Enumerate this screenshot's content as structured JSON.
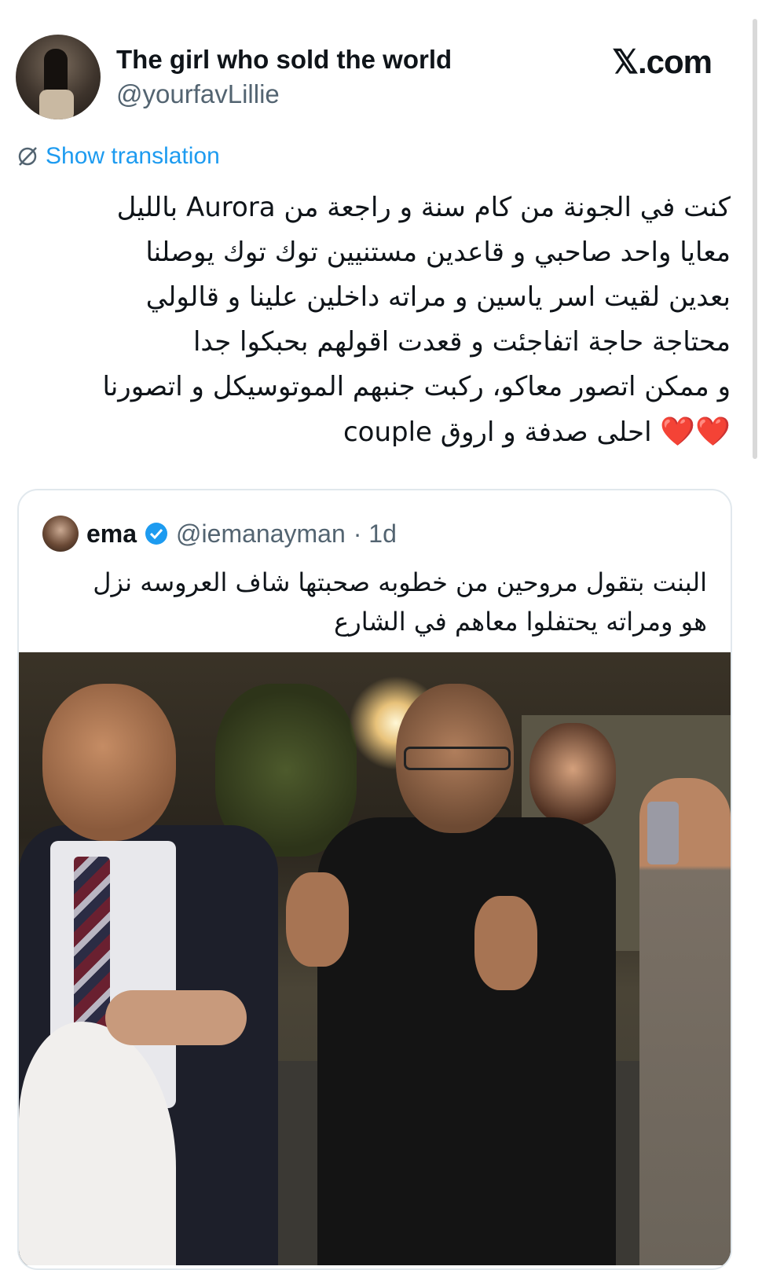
{
  "author": {
    "display_name": "The girl who sold the world",
    "handle": "@yourfavLillie"
  },
  "brand": "𝕏.com",
  "translate_label": "Show translation",
  "tweet_lines": [
    "كنت في الجونة من كام سنة و راجعة من Aurora بالليل",
    "معايا واحد صاحبي و قاعدين مستنيين توك توك يوصلنا",
    "بعدين لقيت اسر ياسين و مراته داخلين علينا و قالولي",
    "محتاجة حاجة اتفاجئت        و قعدت اقولهم بحبكوا جدا",
    "و ممكن اتصور معاكو، ركبت جنبهم الموتوسيكل و اتصورنا",
    "احلى صدفة و اروق couple"
  ],
  "tweet_hearts": "❤️❤️",
  "quote": {
    "name": "ema",
    "handle": "@iemanayman",
    "time": "· 1d",
    "lines": [
      "البنت بتقول مروحين من خطوبه صحبتها شاف العروسه نزل",
      "هو ومراته يحتفلوا معاهم في الشارع"
    ]
  },
  "colors": {
    "link": "#1d9bf0",
    "verified": "#1d9bf0",
    "heart": "#e0245e",
    "muted": "#536471"
  }
}
